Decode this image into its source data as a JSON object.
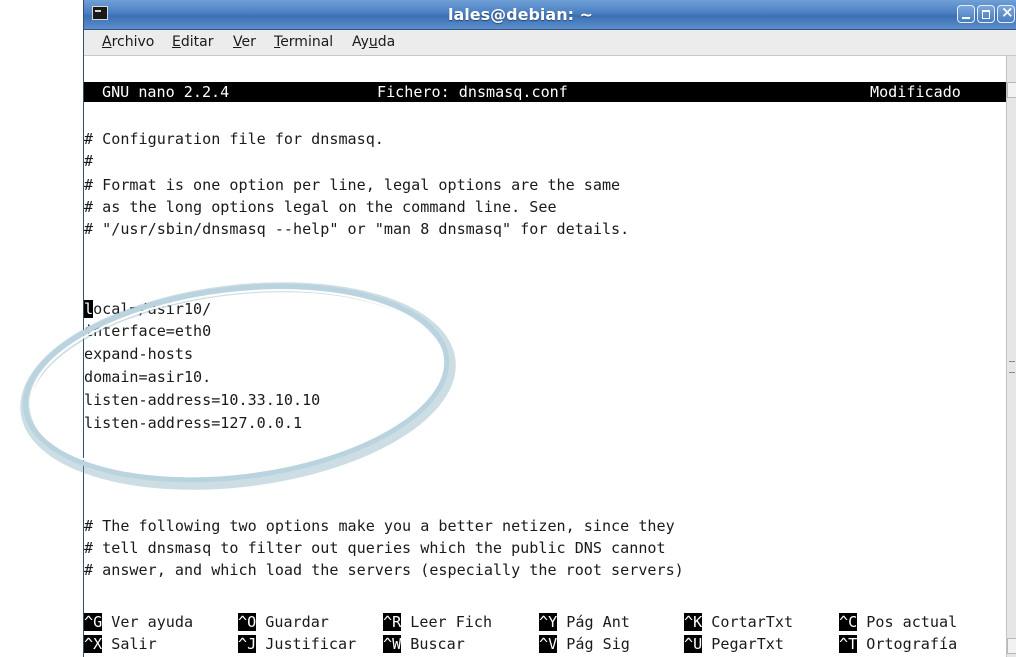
{
  "window": {
    "title": "lales@debian: ~"
  },
  "menu": {
    "items": [
      {
        "mnemonic": "A",
        "rest": "rchivo"
      },
      {
        "mnemonic": "E",
        "rest": "ditar"
      },
      {
        "mnemonic": "V",
        "rest": "er"
      },
      {
        "mnemonic": "T",
        "rest": "erminal"
      },
      {
        "pre": "Ay",
        "mnemonic": "u",
        "rest": "da"
      }
    ]
  },
  "nano": {
    "version": "GNU nano 2.2.4",
    "file": "Fichero: dnsmasq.conf",
    "status": "Modificado"
  },
  "content": {
    "comments_top": [
      "# Configuration file for dnsmasq.",
      "#",
      "# Format is one option per line, legal options are the same",
      "# as the long options legal on the command line. See",
      "# \"/usr/sbin/dnsmasq --help\" or \"man 8 dnsmasq\" for details."
    ],
    "cursor_char": "l",
    "first_line_rest": "ocal=/asir10/",
    "config_lines": [
      "interface=eth0",
      "expand-hosts",
      "domain=asir10.",
      "listen-address=10.33.10.10",
      "listen-address=127.0.0.1"
    ],
    "comments_bottom": [
      "# The following two options make you a better netizen, since they",
      "# tell dnsmasq to filter out queries which the public DNS cannot",
      "# answer, and which load the servers (especially the root servers)"
    ]
  },
  "shortcuts": {
    "row1": [
      {
        "key": "^G",
        "label": "Ver ayuda"
      },
      {
        "key": "^O",
        "label": "Guardar"
      },
      {
        "key": "^R",
        "label": "Leer Fich"
      },
      {
        "key": "^Y",
        "label": "Pág Ant"
      },
      {
        "key": "^K",
        "label": "CortarTxt"
      },
      {
        "key": "^C",
        "label": "Pos actual"
      }
    ],
    "row2": [
      {
        "key": "^X",
        "label": "Salir"
      },
      {
        "key": "^J",
        "label": "Justificar"
      },
      {
        "key": "^W",
        "label": "Buscar"
      },
      {
        "key": "^V",
        "label": "Pág Sig"
      },
      {
        "key": "^U",
        "label": "PegarTxt"
      },
      {
        "key": "^T",
        "label": "Ortografía"
      }
    ]
  },
  "colors": {
    "titlebar": "#4a7fc1",
    "annotation_ring": "#8fb7c9",
    "terminal_fg": "#1a1a1a",
    "terminal_bg": "#ffffff"
  }
}
